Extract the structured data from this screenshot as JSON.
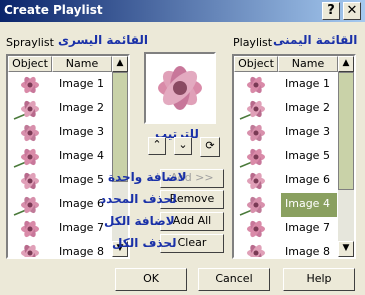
{
  "window": {
    "title": "Create Playlist",
    "help_btn": "?",
    "close_btn": "✕"
  },
  "left": {
    "label": "Spraylist",
    "label_ar": "القائمة اليسرى",
    "columns": [
      "Object",
      "Name"
    ],
    "items": [
      "Image 1",
      "Image 2",
      "Image 3",
      "Image 4",
      "Image 5",
      "Image 6",
      "Image 7",
      "Image 8"
    ]
  },
  "right": {
    "label": "Playlist",
    "label_ar": "القائمة اليمنى",
    "columns": [
      "Object",
      "Name"
    ],
    "items": [
      "Image 1",
      "Image 2",
      "Image 3",
      "Image 5",
      "Image 6",
      "Image 4",
      "Image 7",
      "Image 8"
    ],
    "selected_index": 5
  },
  "order_label_ar": "للترتيب",
  "actions": {
    "add": "Add >>",
    "remove": "Remove",
    "add_all": "Add All",
    "clear": "Clear",
    "add_ar": "لاضافة واحدة",
    "remove_ar": "لحذف المحدد",
    "add_all_ar": "لاضافة الكل",
    "clear_ar": "لحذف الكل"
  },
  "footer": {
    "ok": "OK",
    "cancel": "Cancel",
    "help": "Help"
  },
  "colors": {
    "title_start": "#0a246a",
    "selection": "#8aa060",
    "arabic_text": "#1a31a8"
  }
}
